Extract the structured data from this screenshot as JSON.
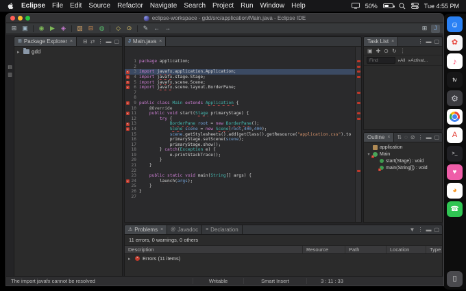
{
  "menubar": {
    "app_name": "Eclipse",
    "items": [
      "File",
      "Edit",
      "Source",
      "Refactor",
      "Navigate",
      "Search",
      "Project",
      "Run",
      "Window",
      "Help"
    ],
    "battery": "50%",
    "clock": "Tue 4:55 PM"
  },
  "window": {
    "title": "eclipse-workspace - gdd/src/application/Main.java - Eclipse IDE",
    "toolbar_icons": [
      {
        "name": "new-wizard",
        "glyph": "⊞",
        "color": "#b9c0c4"
      },
      {
        "name": "save",
        "glyph": "▣",
        "color": "#9db6c6"
      },
      {
        "sep": true
      },
      {
        "name": "debug",
        "glyph": "◉",
        "color": "#7fba57"
      },
      {
        "name": "run",
        "glyph": "▶",
        "color": "#7fba57"
      },
      {
        "name": "external-tools",
        "glyph": "◈",
        "color": "#c97bd1"
      },
      {
        "sep": true
      },
      {
        "name": "new-java-project",
        "glyph": "▧",
        "color": "#d2a267"
      },
      {
        "name": "new-package",
        "glyph": "⊟",
        "color": "#c9874f"
      },
      {
        "name": "new-class",
        "glyph": "◍",
        "color": "#57b86a"
      },
      {
        "sep": true
      },
      {
        "name": "open-type",
        "glyph": "◇",
        "color": "#d6c35f"
      },
      {
        "name": "search",
        "glyph": "⊙",
        "color": "#e0c46a"
      },
      {
        "sep": true
      },
      {
        "name": "last-edit",
        "glyph": "✎",
        "color": "#b9c0c4"
      },
      {
        "name": "back",
        "glyph": "←",
        "color": "#b9c0c4"
      },
      {
        "name": "forward",
        "glyph": "→",
        "color": "#b9c0c4"
      }
    ],
    "perspective_icons": [
      {
        "name": "open-perspective-icon",
        "glyph": "⊞",
        "color": "#b9c0c4"
      },
      {
        "name": "java-perspective-button",
        "glyph": "J",
        "color": "#7aa3d0",
        "active": true
      }
    ],
    "left_strip": [
      {
        "name": "minimized-view-icon-1",
        "glyph": "▤"
      },
      {
        "name": "minimized-view-icon-2",
        "glyph": "▥"
      }
    ]
  },
  "dock": {
    "items": [
      {
        "name": "finder",
        "bg": "#2a81f4",
        "glyph": "☺",
        "fg": "#ffffff",
        "fs": 12
      },
      {
        "name": "app-red-white",
        "bg": "#f5f5f7",
        "glyph": "✿",
        "fg": "#e8453c",
        "fs": 11
      },
      {
        "name": "music",
        "bg": "#ffffff",
        "glyph": "♪",
        "fg": "#fb446c",
        "fs": 12
      },
      {
        "name": "apple-tv",
        "bg": "#161617",
        "glyph": "tv",
        "fg": "#ffffff",
        "fs": 8
      },
      {
        "name": "settings",
        "bg": "#3c3c40",
        "glyph": "⚙",
        "fg": "#c9c9ce",
        "fs": 12
      },
      {
        "name": "chrome",
        "cls": "chrome",
        "glyph": "",
        "fg": "",
        "fs": 10
      },
      {
        "name": "acrobat",
        "bg": "#ffffff",
        "glyph": "A",
        "fg": "#e2342a",
        "fs": 11
      },
      {
        "name": "terminal",
        "bg": "#202024",
        "glyph": ">_",
        "fg": "#e8e8e8",
        "fs": 7
      },
      {
        "name": "app-pink",
        "bg": "#ef5da8",
        "glyph": "♥",
        "fg": "#ffffff",
        "fs": 10
      },
      {
        "name": "app-orange",
        "bg": "#ffffff",
        "glyph": "◕",
        "fg": "#f7941d",
        "fs": 11
      },
      {
        "name": "app-green",
        "bg": "#30c553",
        "glyph": "☎",
        "fg": "#ffffff",
        "fs": 10
      },
      {
        "name": "trash",
        "cls": "trash",
        "glyph": "▯",
        "fg": "#e0e0e0",
        "fs": 11
      }
    ]
  },
  "package_explorer": {
    "tab": "Package Explorer",
    "header_icons": [
      {
        "name": "collapse-all-icon",
        "glyph": "⊟"
      },
      {
        "name": "link-editor-icon",
        "glyph": "⇄"
      },
      {
        "name": "view-menu-icon",
        "glyph": "⋮"
      },
      {
        "name": "minimize-icon",
        "glyph": "▬"
      },
      {
        "name": "maximize-icon",
        "glyph": "▢"
      }
    ],
    "tree": [
      {
        "label": "gdd",
        "expand": "▸"
      }
    ]
  },
  "editor": {
    "tab": "Main.java",
    "lines": [
      {
        "n": 1,
        "t": [
          [
            "k",
            "package"
          ],
          [
            "p",
            " application;"
          ]
        ]
      },
      {
        "n": 2,
        "t": []
      },
      {
        "n": 3,
        "cur": true,
        "err": true,
        "t": [
          [
            "k",
            "import"
          ],
          [
            "p",
            " "
          ],
          [
            "pu",
            "javafx"
          ],
          [
            "p",
            ".application.Application;"
          ]
        ]
      },
      {
        "n": 4,
        "err": true,
        "t": [
          [
            "k",
            "import"
          ],
          [
            "p",
            " "
          ],
          [
            "pu",
            "javafx"
          ],
          [
            "p",
            ".stage.Stage;"
          ]
        ]
      },
      {
        "n": 5,
        "err": true,
        "t": [
          [
            "k",
            "import"
          ],
          [
            "p",
            " "
          ],
          [
            "pu",
            "javafx"
          ],
          [
            "p",
            ".scene.Scene;"
          ]
        ]
      },
      {
        "n": 6,
        "err": true,
        "t": [
          [
            "k",
            "import"
          ],
          [
            "p",
            " "
          ],
          [
            "pu",
            "javafx"
          ],
          [
            "p",
            ".scene.layout.BorderPane;"
          ]
        ]
      },
      {
        "n": 7,
        "t": []
      },
      {
        "n": 8,
        "t": []
      },
      {
        "n": 9,
        "err": true,
        "t": [
          [
            "k",
            "public"
          ],
          [
            "p",
            " "
          ],
          [
            "k",
            "class"
          ],
          [
            "p",
            " "
          ],
          [
            "t",
            "Main"
          ],
          [
            "p",
            " "
          ],
          [
            "k",
            "extends"
          ],
          [
            "p",
            " "
          ],
          [
            "tu",
            "Application"
          ],
          [
            "p",
            " {"
          ]
        ]
      },
      {
        "n": 10,
        "t": [
          [
            "p",
            "    "
          ],
          [
            "a",
            "@Override"
          ]
        ]
      },
      {
        "n": 11,
        "err": true,
        "t": [
          [
            "p",
            "    "
          ],
          [
            "k",
            "public"
          ],
          [
            "p",
            " "
          ],
          [
            "k",
            "void"
          ],
          [
            "p",
            " start("
          ],
          [
            "tu",
            "Stage"
          ],
          [
            "p",
            " primaryStage) {"
          ]
        ]
      },
      {
        "n": 12,
        "t": [
          [
            "p",
            "        "
          ],
          [
            "k",
            "try"
          ],
          [
            "p",
            " {"
          ]
        ]
      },
      {
        "n": 13,
        "err": true,
        "t": [
          [
            "p",
            "            "
          ],
          [
            "tu",
            "BorderPane"
          ],
          [
            "p",
            " "
          ],
          [
            "v",
            "root"
          ],
          [
            "p",
            " = "
          ],
          [
            "k",
            "new"
          ],
          [
            "p",
            " "
          ],
          [
            "tu",
            "BorderPane"
          ],
          [
            "p",
            "();"
          ]
        ]
      },
      {
        "n": 14,
        "err": true,
        "t": [
          [
            "p",
            "            "
          ],
          [
            "tu",
            "Scene"
          ],
          [
            "p",
            " "
          ],
          [
            "v",
            "scene"
          ],
          [
            "p",
            " = "
          ],
          [
            "k",
            "new"
          ],
          [
            "p",
            " "
          ],
          [
            "tu",
            "Scene"
          ],
          [
            "p",
            "("
          ],
          [
            "v",
            "root"
          ],
          [
            "p",
            ","
          ],
          [
            "n2",
            "400"
          ],
          [
            "p",
            ","
          ],
          [
            "n2",
            "400"
          ],
          [
            "p",
            ");"
          ]
        ]
      },
      {
        "n": 15,
        "t": [
          [
            "p",
            "            "
          ],
          [
            "v",
            "scene"
          ],
          [
            "p",
            ".getStylesheets().add(getClass().getResource("
          ],
          [
            "s",
            "\"application.css\""
          ],
          [
            "p",
            ").to"
          ]
        ]
      },
      {
        "n": 16,
        "t": [
          [
            "p",
            "            primaryStage.setScene("
          ],
          [
            "v",
            "scene"
          ],
          [
            "p",
            ");"
          ]
        ]
      },
      {
        "n": 17,
        "t": [
          [
            "p",
            "            primaryStage.show();"
          ]
        ]
      },
      {
        "n": 18,
        "t": [
          [
            "p",
            "        } "
          ],
          [
            "k",
            "catch"
          ],
          [
            "p",
            "("
          ],
          [
            "t",
            "Exception"
          ],
          [
            "p",
            " e) {"
          ]
        ]
      },
      {
        "n": 19,
        "t": [
          [
            "p",
            "            e.printStackTrace();"
          ]
        ]
      },
      {
        "n": 20,
        "t": [
          [
            "p",
            "        }"
          ]
        ]
      },
      {
        "n": 21,
        "t": [
          [
            "p",
            "    }"
          ]
        ]
      },
      {
        "n": 22,
        "t": []
      },
      {
        "n": 23,
        "t": [
          [
            "p",
            "    "
          ],
          [
            "k",
            "public"
          ],
          [
            "p",
            " "
          ],
          [
            "k",
            "static"
          ],
          [
            "p",
            " "
          ],
          [
            "k",
            "void"
          ],
          [
            "p",
            " main("
          ],
          [
            "t",
            "String"
          ],
          [
            "p",
            "[] args) {"
          ]
        ]
      },
      {
        "n": 24,
        "err": true,
        "t": [
          [
            "p",
            "        "
          ],
          [
            "pu",
            "launch"
          ],
          [
            "p",
            "("
          ],
          [
            "v",
            "args"
          ],
          [
            "p",
            ");"
          ]
        ]
      },
      {
        "n": 25,
        "t": [
          [
            "p",
            "    }"
          ]
        ]
      },
      {
        "n": 26,
        "t": [
          [
            "p",
            "}"
          ]
        ]
      },
      {
        "n": 27,
        "t": []
      }
    ]
  },
  "task_list": {
    "tab": "Task List",
    "header_icons": [
      {
        "name": "view-menu-icon",
        "glyph": "⋮"
      },
      {
        "name": "minimize-icon",
        "glyph": "▬"
      },
      {
        "name": "maximize-icon",
        "glyph": "▢"
      }
    ],
    "toolbar_icons": [
      {
        "name": "new-task-icon",
        "glyph": "▣"
      },
      {
        "name": "add-task-icon",
        "glyph": "✚"
      },
      {
        "name": "scheduled-icon",
        "glyph": "⊙"
      },
      {
        "name": "sync-icon",
        "glyph": "↻"
      },
      {
        "name": "more-icon",
        "glyph": "⋮"
      }
    ],
    "find_placeholder": "Find",
    "filters": [
      {
        "label": "All"
      },
      {
        "label": "Activat..."
      }
    ]
  },
  "outline": {
    "tab": "Outline",
    "header_icons": [
      {
        "name": "sort-icon",
        "glyph": "⇅"
      },
      {
        "name": "hide-fields-icon",
        "glyph": "◌"
      },
      {
        "name": "hide-static-icon",
        "glyph": "⊘"
      },
      {
        "name": "view-menu-icon",
        "glyph": "⋮"
      },
      {
        "name": "minimize-icon",
        "glyph": "▬"
      },
      {
        "name": "maximize-icon",
        "glyph": "▢"
      }
    ],
    "items": [
      {
        "label": "application",
        "kind": "package",
        "indent": 0,
        "expand": "",
        "error": false
      },
      {
        "label": "Main",
        "kind": "class",
        "indent": 0,
        "expand": "▾",
        "error": true
      },
      {
        "label": "start(Stage) : void",
        "kind": "method",
        "indent": 1,
        "expand": "",
        "error": false
      },
      {
        "label": "main(String[]) : void",
        "kind": "method",
        "indent": 1,
        "expand": "",
        "error": true
      }
    ]
  },
  "problems": {
    "tabs": [
      {
        "label": "Problems",
        "glyph": "⚠",
        "active": true
      },
      {
        "label": "Javadoc",
        "glyph": "@",
        "active": false
      },
      {
        "label": "Declaration",
        "glyph": "≡",
        "active": false
      }
    ],
    "header_icons": [
      {
        "name": "filter-icon",
        "glyph": "▼"
      },
      {
        "name": "view-menu-icon",
        "glyph": "⋮"
      },
      {
        "name": "minimize-icon",
        "glyph": "▬"
      },
      {
        "name": "maximize-icon",
        "glyph": "▢"
      }
    ],
    "summary": "11 errors, 0 warnings, 0 others",
    "columns": [
      "Description",
      "Resource",
      "Path",
      "Location",
      "Type"
    ],
    "rows": [
      {
        "label": "Errors (11 items)",
        "expand": "▸"
      }
    ]
  },
  "status": {
    "message": "The import javafx cannot be resolved",
    "writable": "Writable",
    "insert_mode": "Smart Insert",
    "position": "3 : 11 : 33"
  }
}
